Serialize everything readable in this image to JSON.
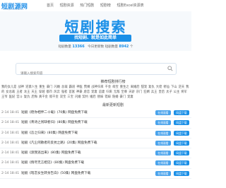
{
  "brand": {
    "name": "短剧源网",
    "sub": "DUANJUYUANWANG"
  },
  "nav": [
    "首页",
    "短剧资源",
    "热门短剧",
    "短剧榜",
    "短剧Excel资源表"
  ],
  "hero": {
    "title": "短剧搜索",
    "slogan": "找短剧、就是如此简单",
    "stats": {
      "total_label": "短剧数量",
      "total": "13366",
      "today_label": "今日更新数",
      "today_prefix": "短剧数量",
      "today": "8942",
      "unit": "个"
    }
  },
  "search": {
    "placeholder": "请输入搜索内容"
  },
  "hot": {
    "heading": "推荐短剧排行榜",
    "tags": [
      "我的女儿是",
      "战神",
      "逆袭人生",
      "重生",
      "豪门",
      "闪婚",
      "总裁",
      "霸道",
      "神医",
      "赘婿",
      "战神归来",
      "千金",
      "萌宝",
      "重生之",
      "离婚后",
      "甜宠",
      "复仇",
      "大佬",
      "修仙",
      "下山",
      "逆天",
      "我的",
      "女总裁",
      "王者",
      "龙王",
      "天王",
      "穿越",
      "都市",
      "风云",
      "强者",
      "首富",
      "神豪",
      "虐恋",
      "宠妻",
      "追妻",
      "归来",
      "无敌",
      "至尊",
      "天骄",
      "宗门",
      "狂婿",
      "兵王",
      "皇后",
      "太子",
      "公主",
      "将军",
      "王爷",
      "医妃",
      "宫斗",
      "复仇",
      "后悔",
      "真千金",
      "假千金",
      "双宝",
      "三宝",
      "闪婚",
      "契约",
      "婚后",
      "替嫁",
      "错嫁",
      "隐婚",
      "豪门",
      "宠妻"
    ]
  },
  "latest": {
    "heading": "最新更新短剧",
    "online_label": "在线观看",
    "download_label": "网盘下载",
    "items": [
      {
        "date": "2-14 18:41",
        "title": "短剧《稳你相伴二十载》(70集) 网盘免费下载"
      },
      {
        "date": "2-14 18:41",
        "title": "短剧《青诗之残缺者归》(80集) 网盘免费下载"
      },
      {
        "date": "2-14 18:41",
        "title": "短剧《吾之归来》(80集) 网盘免费下载"
      },
      {
        "date": "2-14 18:41",
        "title": "短剧《凡尘闲散者的反抗之路》(20集) 网盘免费下载"
      },
      {
        "date": "2-14 18:41",
        "title": "短剧《渡我逃出来》(80集) 网盘免费下载"
      },
      {
        "date": "2-14 18:41",
        "title": "短剧《情尽无言相见》(80集) 网盘免费下载"
      },
      {
        "date": "2-14 18:41",
        "title": "短剧《暗恋女生转身告白》(50集) 网盘免费下载"
      }
    ]
  }
}
